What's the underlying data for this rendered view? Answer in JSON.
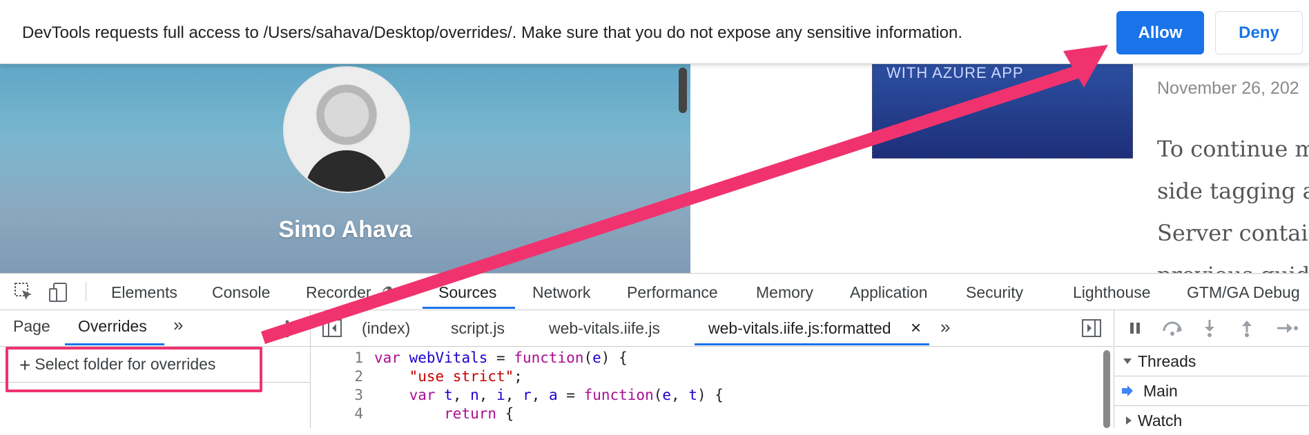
{
  "permission_bar": {
    "message": "DevTools requests full access to /Users/sahava/Desktop/overrides/. Make sure that you do not expose any sensitive information.",
    "allow_label": "Allow",
    "deny_label": "Deny"
  },
  "page": {
    "author_name": "Simo Ahava",
    "thumbnail_caption": "WITH AZURE APP ",
    "post_date": "November 26, 202",
    "post_lines": [
      "To continue m",
      "side tagging ar",
      "Server contain",
      "previous guide"
    ]
  },
  "devtools": {
    "tabs": [
      "Elements",
      "Console",
      "Recorder",
      "Sources",
      "Network",
      "Performance",
      "Memory",
      "Application",
      "Security",
      "Lighthouse",
      "GTM/GA Debug"
    ],
    "active_tab": "Sources",
    "left_tabs": [
      "Page",
      "Overrides"
    ],
    "more_glyph": "»",
    "select_folder_label": "Select folder for overrides",
    "file_tabs": [
      "(index)",
      "script.js",
      "web-vitals.iife.js",
      "web-vitals.iife.js:formatted"
    ],
    "close_glyph": "×",
    "code_lines": [
      {
        "n": "1",
        "text": "var webVitals = function(e) {"
      },
      {
        "n": "2",
        "text": "    \"use strict\";"
      },
      {
        "n": "3",
        "text": "    var t, n, i, r, a = function(e, t) {"
      },
      {
        "n": "4",
        "text": "        return {"
      }
    ],
    "debugger": {
      "threads_label": "Threads",
      "main_label": "Main",
      "watch_label": "Watch"
    }
  },
  "colors": {
    "accent": "#1a73e8",
    "annotation": "#f0336e"
  }
}
